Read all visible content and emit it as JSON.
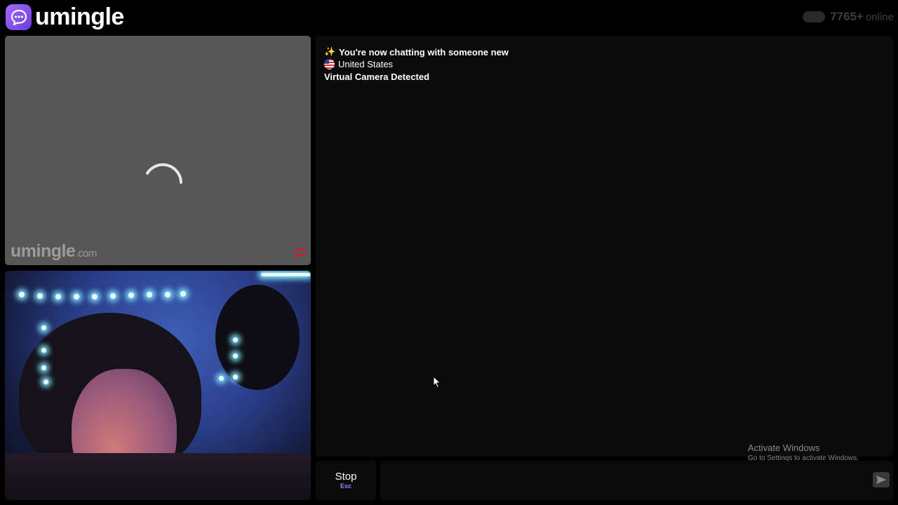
{
  "header": {
    "logo_text": "umingle",
    "online_count": "7765+",
    "online_label": "online"
  },
  "stranger_video": {
    "watermark_name": "umingle",
    "watermark_suffix": ".com"
  },
  "chat": {
    "messages": [
      {
        "icon": "sparkle-icon",
        "text": "You're now chatting with someone new"
      },
      {
        "icon": "us-flag-icon",
        "text": "United States"
      },
      {
        "icon": "",
        "text": "Virtual Camera Detected"
      }
    ]
  },
  "controls": {
    "stop_label": "Stop",
    "stop_shortcut": "Esc",
    "message_value": "",
    "message_placeholder": ""
  },
  "windows_notice": {
    "title": "Activate Windows",
    "subtitle": "Go to Settings to activate Windows."
  },
  "colors": {
    "brand": "#8b55f2",
    "background": "#000000",
    "panel": "#0b0b0b",
    "video_placeholder": "#575757",
    "shortcut": "#a07cff"
  }
}
